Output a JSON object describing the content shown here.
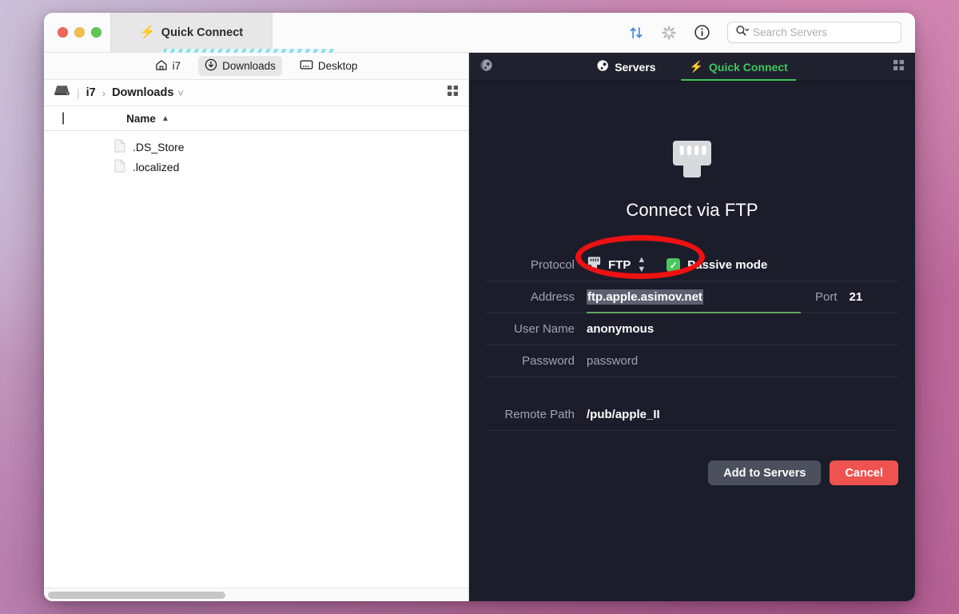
{
  "window": {
    "traffic_lights": [
      "close",
      "minimize",
      "zoom"
    ],
    "tab": {
      "label": "Quick Connect",
      "icon": "bolt-icon"
    },
    "toolbar": {
      "transfers_icon": "transfer-arrows-icon",
      "activity_icon": "spinner-icon",
      "info_icon": "info-circle-icon",
      "search": {
        "placeholder": "Search Servers",
        "icon": "search-icon",
        "value": ""
      }
    }
  },
  "left_panel": {
    "favorites": [
      {
        "label": "i7",
        "icon": "home-icon",
        "active": false
      },
      {
        "label": "Downloads",
        "icon": "download-circle-icon",
        "active": true
      },
      {
        "label": "Desktop",
        "icon": "desktop-icon",
        "active": false
      }
    ],
    "path": {
      "drive_icon": "hard-drive-icon",
      "root": "i7",
      "separator": "›",
      "current": "Downloads",
      "dropdown_icon": "chevron-down-icon",
      "view_icon": "grid-view-icon"
    },
    "columns": [
      {
        "label": "Name",
        "sort": "ascending",
        "sort_icon": "caret-up-icon"
      }
    ],
    "files": [
      {
        "name": ".DS_Store",
        "icon": "file-icon"
      },
      {
        "name": ".localized",
        "icon": "file-icon"
      }
    ],
    "scrollbar": "horizontal-scrollbar"
  },
  "right_panel": {
    "globe_icon": "globe-icon",
    "grid_icon": "grid-view-icon",
    "tabs": [
      {
        "label": "Servers",
        "icon": "globe-icon",
        "active": false
      },
      {
        "label": "Quick Connect",
        "icon": "bolt-icon",
        "active": true
      }
    ],
    "quick_connect": {
      "hero_icon": "ethernet-jack-icon",
      "title": "Connect via FTP",
      "fields": {
        "protocol_label": "Protocol",
        "protocol_value": "FTP",
        "protocol_icon": "ethernet-jack-icon",
        "protocol_stepper_icon": "stepper-updown-icon",
        "passive_label": "Passive mode",
        "passive_checked": "✓",
        "address_label": "Address",
        "address_value": "ftp.apple.asimov.net",
        "port_label": "Port",
        "port_value": "21",
        "username_label": "User Name",
        "username_value": "anonymous",
        "password_label": "Password",
        "password_value": "password",
        "remote_path_label": "Remote Path",
        "remote_path_value": "/pub/apple_II"
      },
      "buttons": {
        "add_to_servers": "Add to Servers",
        "cancel": "Cancel"
      }
    }
  },
  "annotation": {
    "shape": "red-ellipse",
    "color": "#ee1111",
    "targets": "protocol-dropdown"
  },
  "colors": {
    "accent_green": "#3fc75a",
    "panel_dark": "#1c1d2b",
    "tabbar_dark": "#20212f",
    "cancel_red": "#ef5350",
    "desktop": "#c58bb4"
  }
}
